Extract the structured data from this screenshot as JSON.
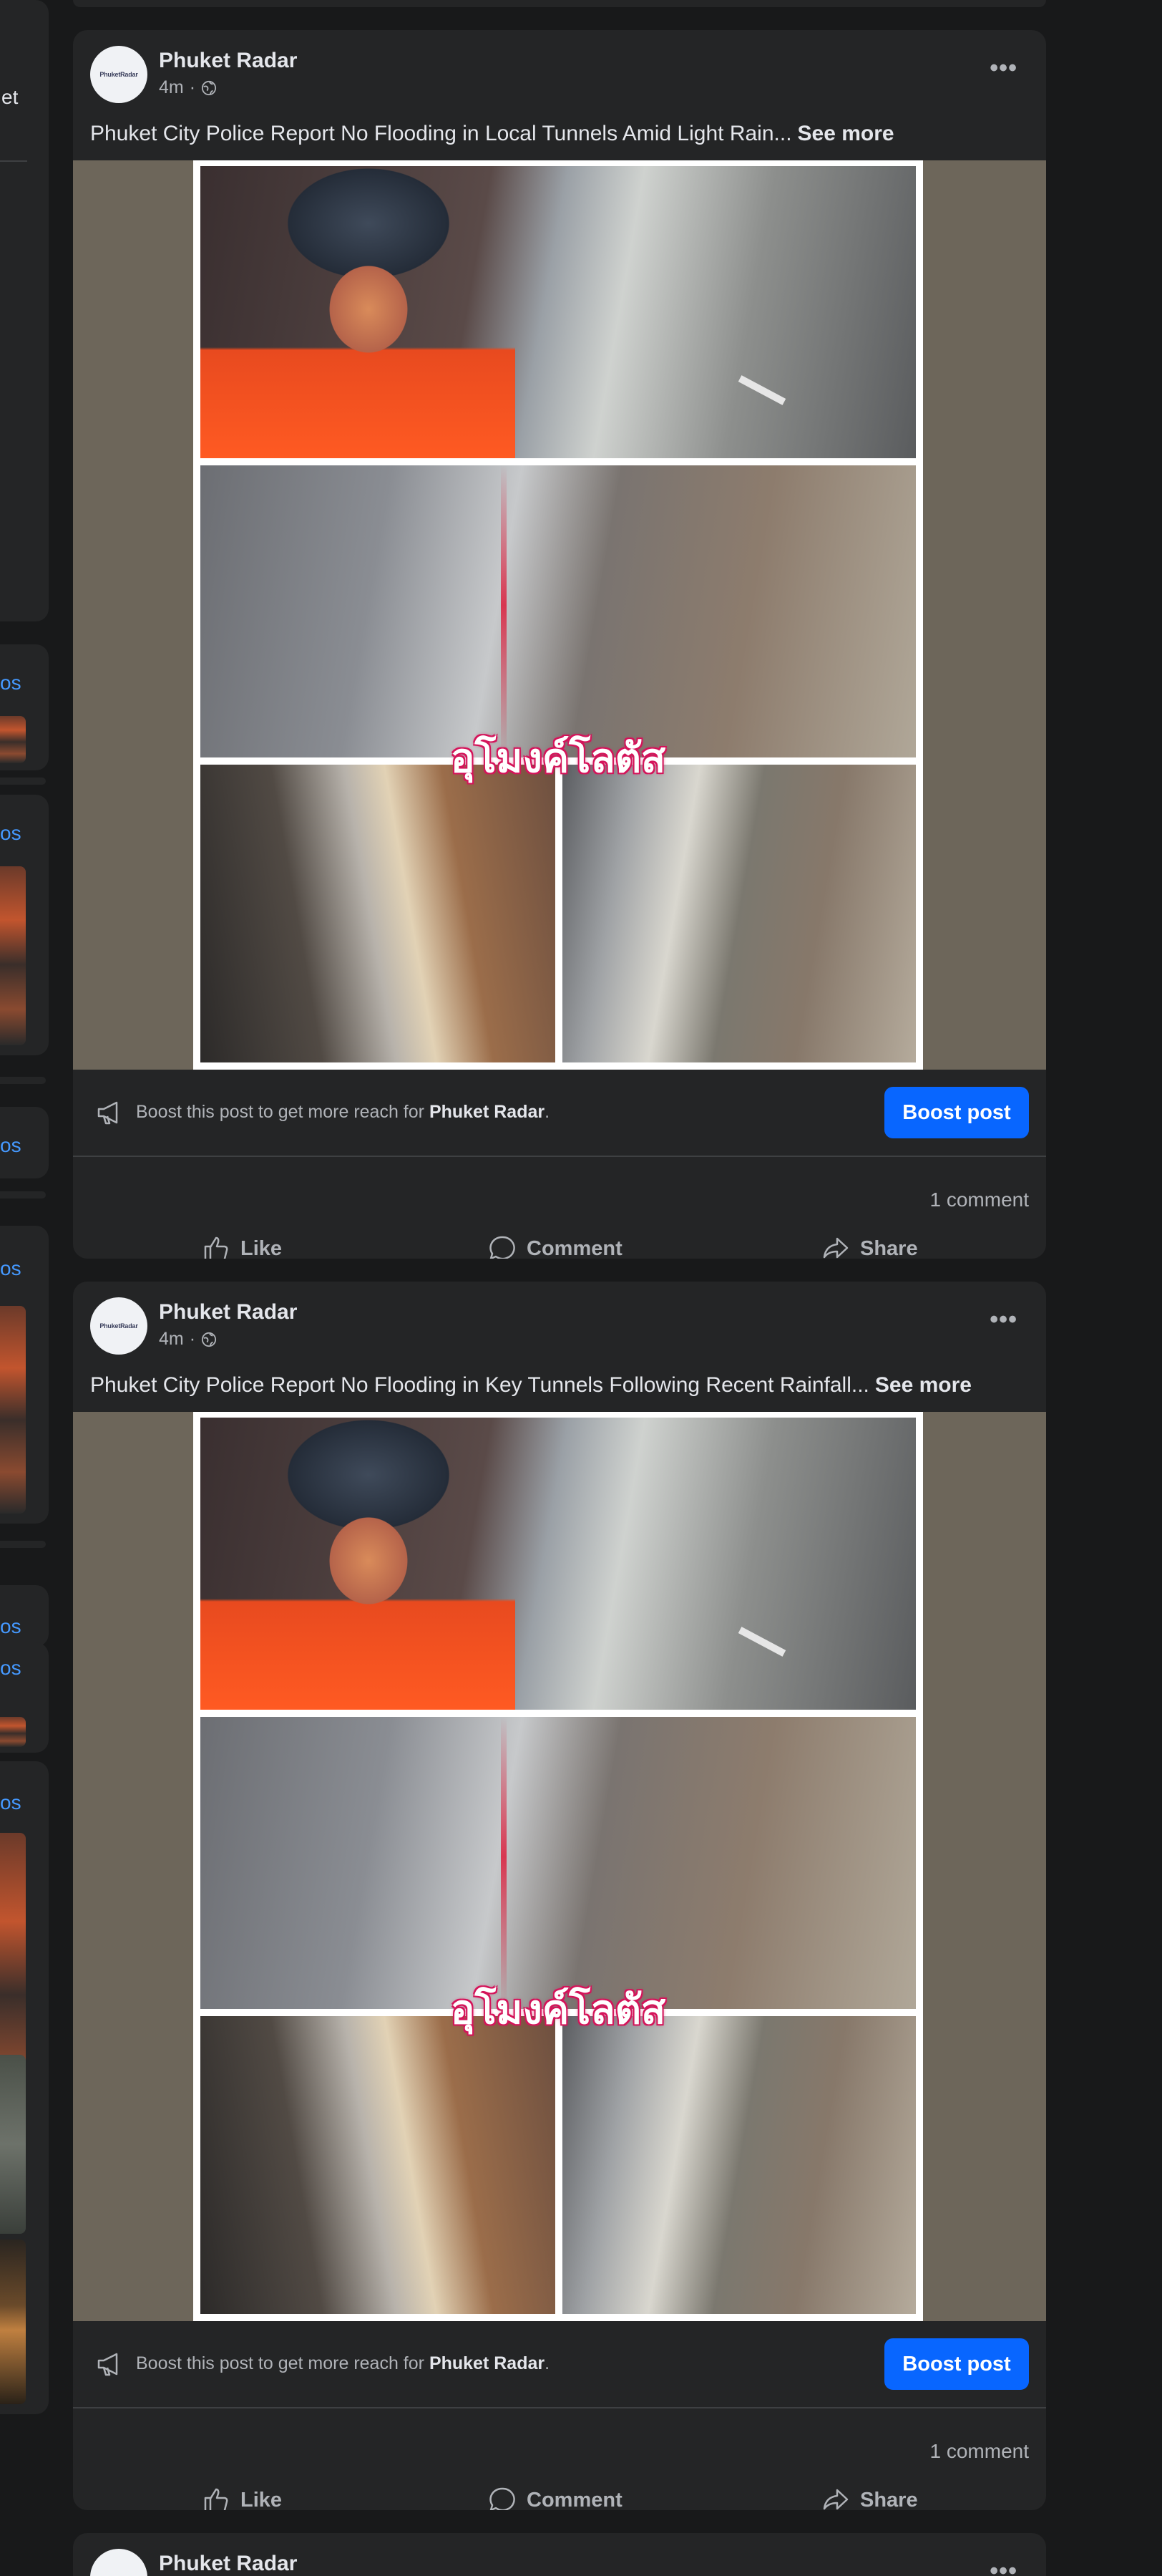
{
  "sidebar": {
    "partial_text": "et",
    "links": [
      "os",
      "os",
      "os",
      "os",
      "os",
      "os",
      "os"
    ]
  },
  "posts": [
    {
      "author": "Phuket Radar",
      "avatar_label": "PhuketRadar",
      "time": "4m",
      "separator": "·",
      "privacy_icon": "globe-icon",
      "more_label": "•••",
      "caption": "Phuket City Police Report No Flooding in Local Tunnels Amid Light Rain...",
      "see_more": "See more",
      "image_overlay_text": "อุโมงค์โลตัส",
      "boost_prefix": "Boost this post to get more reach for",
      "boost_page": "Phuket Radar",
      "boost_suffix": ".",
      "boost_button": "Boost post",
      "comment_count": "1 comment",
      "actions": {
        "like": "Like",
        "comment": "Comment",
        "share": "Share"
      }
    },
    {
      "author": "Phuket Radar",
      "avatar_label": "PhuketRadar",
      "time": "4m",
      "separator": "·",
      "privacy_icon": "globe-icon",
      "more_label": "•••",
      "caption": "Phuket City Police Report No Flooding in Key Tunnels Following Recent Rainfall...",
      "see_more": "See more",
      "image_overlay_text": "อุโมงค์โลตัส",
      "boost_prefix": "Boost this post to get more reach for",
      "boost_page": "Phuket Radar",
      "boost_suffix": ".",
      "boost_button": "Boost post",
      "comment_count": "1 comment",
      "actions": {
        "like": "Like",
        "comment": "Comment",
        "share": "Share"
      }
    },
    {
      "author": "Phuket Radar",
      "more_label": "•••"
    }
  ],
  "colors": {
    "background": "#18191a",
    "card": "#242526",
    "primary_text": "#e4e6eb",
    "secondary_text": "#b0b3b8",
    "accent": "#0866ff",
    "link": "#4599ff"
  }
}
